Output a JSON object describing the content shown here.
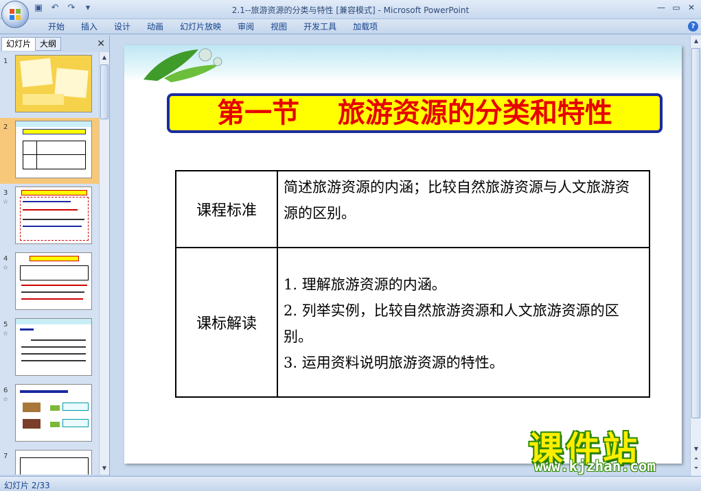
{
  "window": {
    "title": "2.1--旅游资源的分类与特性 [兼容模式] - Microsoft PowerPoint",
    "minimize": "—",
    "maximize": "▭",
    "close": "✕"
  },
  "quick_access": {
    "save_icon": "floppy-disk-icon",
    "undo_icon": "undo-icon",
    "redo_icon": "redo-icon"
  },
  "ribbon": {
    "tabs": [
      "开始",
      "插入",
      "设计",
      "动画",
      "幻灯片放映",
      "审阅",
      "视图",
      "开发工具",
      "加载项"
    ],
    "help": "?"
  },
  "left_panel": {
    "tabs": [
      "幻灯片",
      "大纲"
    ],
    "close": "✕",
    "slides": [
      {
        "num": "1",
        "fx": "",
        "selected": false
      },
      {
        "num": "2",
        "fx": "",
        "selected": true
      },
      {
        "num": "3",
        "fx": "☆",
        "selected": false
      },
      {
        "num": "4",
        "fx": "☆",
        "selected": false
      },
      {
        "num": "5",
        "fx": "☆",
        "selected": false
      },
      {
        "num": "6",
        "fx": "☆",
        "selected": false
      },
      {
        "num": "7",
        "fx": "",
        "selected": false
      }
    ]
  },
  "slide": {
    "title": "第一节    旅游资源的分类和特性",
    "table": {
      "rows": [
        {
          "label": "课程标准",
          "content": [
            "简述旅游资源的内涵；比较自然旅游资源与人文旅游资源的区别。"
          ]
        },
        {
          "label": "课标解读",
          "content": [
            "1. 理解旅游资源的内涵。",
            "2. 列举实例，比较自然旅游资源和人文旅游资源的区别。",
            "3. 运用资料说明旅游资源的特性。"
          ]
        }
      ]
    }
  },
  "status": {
    "slide_counter": "幻灯片 2/33"
  },
  "watermark": {
    "text": "课件站",
    "url": "www.kjzhan.com"
  },
  "colors": {
    "banner_bg": "#ffff00",
    "banner_text": "#e60000",
    "banner_border": "#1a2aa0",
    "selected_thumb": "#f8c87a"
  }
}
